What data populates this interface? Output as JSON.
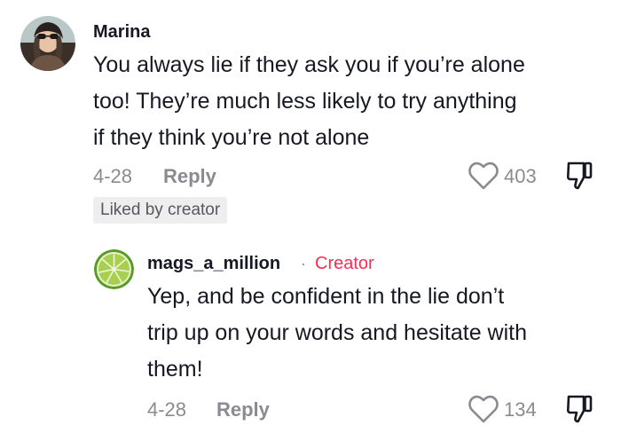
{
  "comments": [
    {
      "username": "Marina",
      "lines": [
        "You always lie if they ask you if you’re alone",
        "too! They’re much less likely to try anything",
        "if they think you’re not alone"
      ],
      "date": "4-28",
      "reply_label": "Reply",
      "like_count": "403",
      "badge": "Liked by creator",
      "avatar_icon": "profile-photo"
    },
    {
      "username": "mags_a_million",
      "separator": "·",
      "creator_label": "Creator",
      "lines": [
        "Yep, and be confident in the lie don’t",
        "trip up on your words and hesitate with",
        "them!"
      ],
      "date": "4-28",
      "reply_label": "Reply",
      "like_count": "134",
      "avatar_icon": "lime-slice"
    }
  ],
  "colors": {
    "text": "#161823",
    "muted": "#8a8b91",
    "creator": "#fe2c55",
    "badge_bg": "#eeeeef"
  },
  "icons": {
    "like": "heart-outline-icon",
    "dislike": "thumbs-down-icon"
  }
}
